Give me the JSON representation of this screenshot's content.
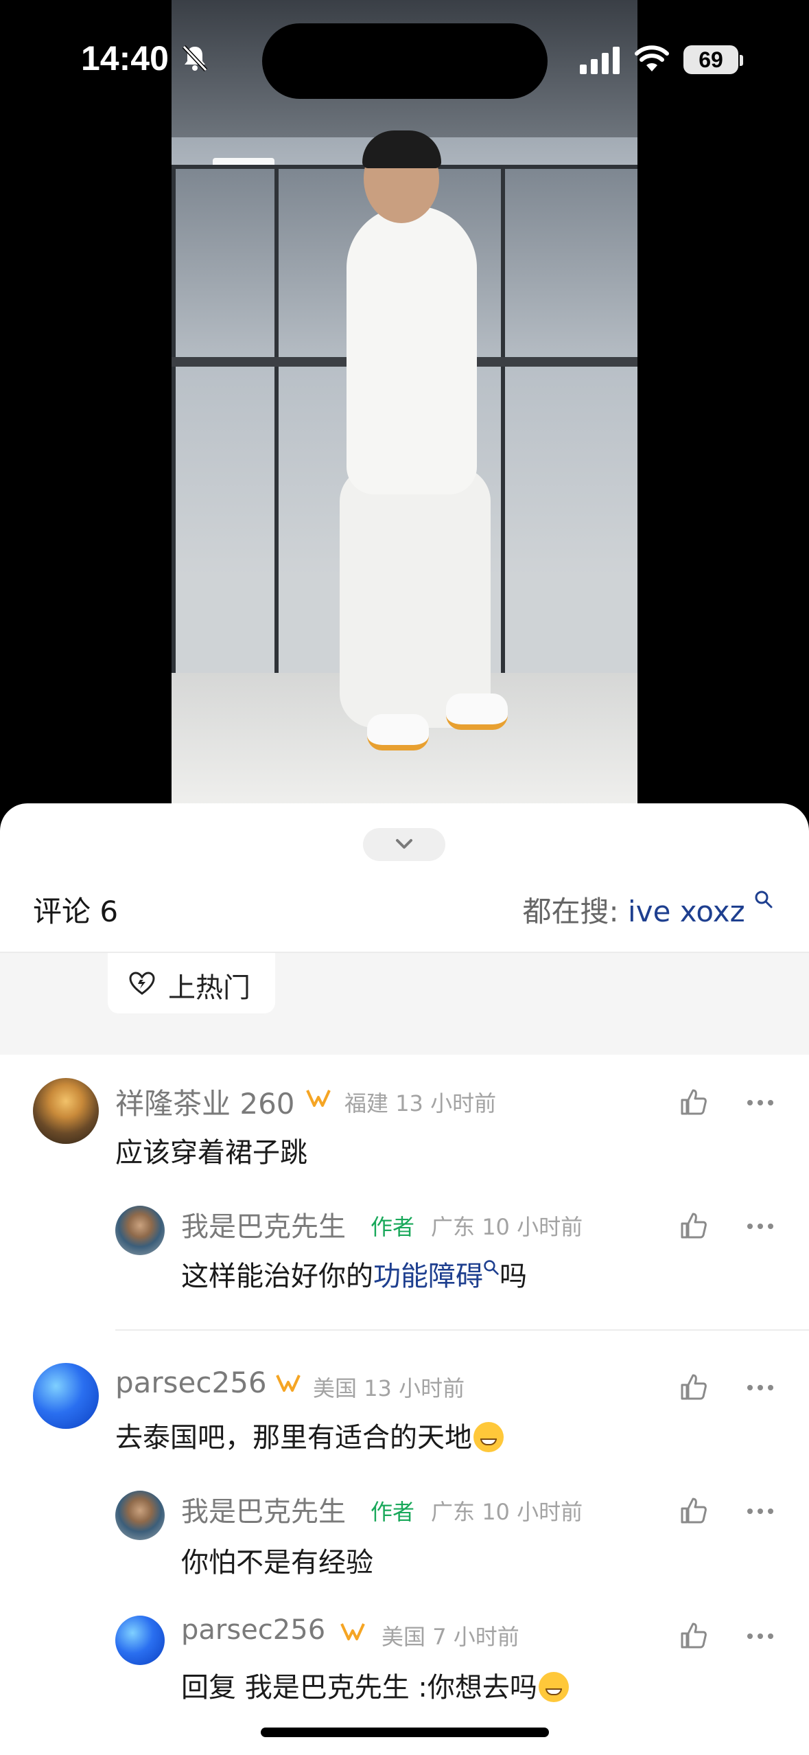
{
  "status_bar": {
    "time": "14:40",
    "battery": "69"
  },
  "sheet": {
    "title": "评论 6",
    "search_prefix": "都在搜: ",
    "search_keyword": "ive xoxz",
    "hot_button": "上热门"
  },
  "comments": [
    {
      "name": "祥隆茶业 260",
      "location": "福建",
      "time": "13 小时前",
      "text": "应该穿着裙子跳",
      "replies": [
        {
          "name": "我是巴克先生",
          "author_badge": "作者",
          "location": "广东",
          "time": "10 小时前",
          "text_before": "这样能治好你的",
          "link": "功能障碍",
          "text_after": "吗"
        }
      ]
    },
    {
      "name": "parsec256",
      "location": "美国",
      "time": "13 小时前",
      "text": "去泰国吧，那里有适合的天地",
      "replies": [
        {
          "name": "我是巴克先生",
          "author_badge": "作者",
          "location": "广东",
          "time": "10 小时前",
          "text": "你怕不是有经验"
        },
        {
          "name": "parsec256",
          "location": "美国",
          "time": "7 小时前",
          "text": "回复 我是巴克先生 :你想去吗"
        }
      ]
    }
  ],
  "icons": {
    "mute": "bell-slash-icon",
    "signal": "cellular-signal-icon",
    "wifi": "wifi-icon",
    "collapse": "chevron-down-icon",
    "search": "search-icon",
    "hot": "heart-flame-icon",
    "like": "thumbs-up-icon",
    "more": "more-dots-icon",
    "vip": "vip-badge-icon"
  },
  "colors": {
    "link": "#1e3f8f",
    "author_badge": "#19a85a",
    "vip": "#f5a524"
  }
}
